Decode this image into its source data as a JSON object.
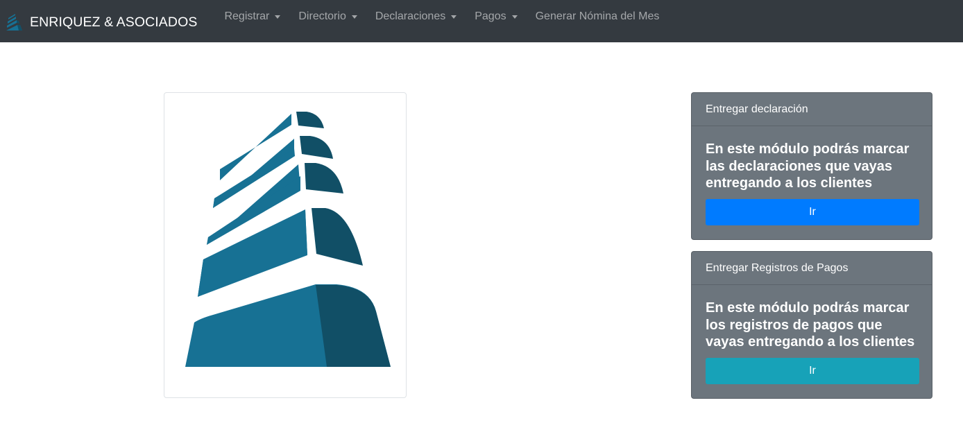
{
  "navbar": {
    "brand": "ENRIQUEZ & ASOCIADOS",
    "items": [
      {
        "label": "Registrar",
        "dropdown": true
      },
      {
        "label": "Directorio",
        "dropdown": true
      },
      {
        "label": "Declaraciones",
        "dropdown": true
      },
      {
        "label": "Pagos",
        "dropdown": true
      },
      {
        "label": "Generar Nómina del Mes",
        "dropdown": false
      }
    ]
  },
  "hero_image": {
    "icon": "building-logo"
  },
  "cards": [
    {
      "header": "Entregar declaración",
      "text": "En este módulo podrás marcar las declaraciones que vayas entregando a los clientes",
      "button": "Ir",
      "button_color": "#007bff"
    },
    {
      "header": "Entregar Registros de Pagos",
      "text": "En este módulo podrás marcar los registros de pagos que vayas entregando a los clientes",
      "button": "Ir",
      "button_color": "#17a2b8"
    }
  ],
  "colors": {
    "navbar": "#343a40",
    "card": "#6c757d",
    "logo_light": "#177194",
    "logo_dark": "#114f66"
  }
}
